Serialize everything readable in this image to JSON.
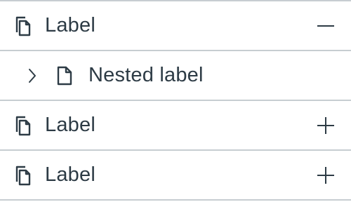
{
  "tree": {
    "items": [
      {
        "label": "Label",
        "icon": "copy-document-icon",
        "toggle": "collapse-minus-icon",
        "expanded": true
      },
      {
        "label": "Nested label",
        "icon": "document-icon",
        "expander": "chevron-right-icon",
        "nested": true
      },
      {
        "label": "Label",
        "icon": "copy-document-icon",
        "toggle": "expand-plus-icon",
        "expanded": false
      },
      {
        "label": "Label",
        "icon": "copy-document-icon",
        "toggle": "expand-plus-icon",
        "expanded": false
      }
    ]
  },
  "colors": {
    "text": "#2d3b45",
    "divider": "#c7cdd1",
    "icon": "#2d3b45"
  }
}
